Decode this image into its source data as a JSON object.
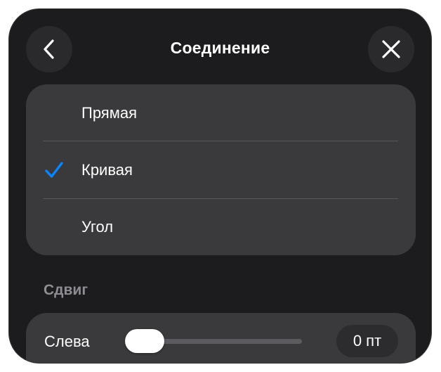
{
  "header": {
    "title": "Соединение"
  },
  "connection_types": [
    {
      "label": "Прямая",
      "selected": false
    },
    {
      "label": "Кривая",
      "selected": true
    },
    {
      "label": "Угол",
      "selected": false
    }
  ],
  "offset_section": {
    "header": "Сдвиг",
    "slider_label": "Слева",
    "value_text": "0 пт",
    "value_fraction": 0
  },
  "colors": {
    "accent": "#0a84ff",
    "panel_bg": "#1c1c1e",
    "card_bg": "#3a3a3c",
    "secondary_text": "#8d8d93"
  },
  "icons": {
    "back": "chevron-left-icon",
    "close": "close-icon",
    "selected": "checkmark-icon"
  }
}
